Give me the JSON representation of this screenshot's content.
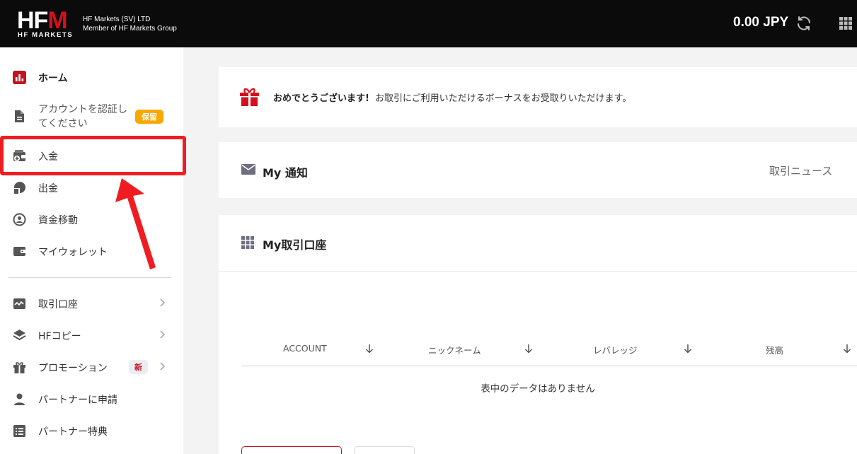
{
  "header": {
    "logo_text": "HFM",
    "logo_sub": "HF MARKETS",
    "company_line1": "HF Markets (SV) LTD",
    "company_line2": "Member of HF Markets Group",
    "balance": "0.00 JPY"
  },
  "sidebar": {
    "items": [
      {
        "label": "ホーム",
        "icon": "chart-icon"
      },
      {
        "label": "アカウントを認証してください",
        "icon": "document-icon",
        "badge": "保留"
      },
      {
        "label": "入金",
        "icon": "wallet-add-icon"
      },
      {
        "label": "出金",
        "icon": "withdraw-icon"
      },
      {
        "label": "資金移動",
        "icon": "transfer-icon"
      },
      {
        "label": "マイウォレット",
        "icon": "wallet-icon"
      },
      {
        "label": "取引口座",
        "icon": "trading-chart-icon"
      },
      {
        "label": "HFコピー",
        "icon": "layers-icon"
      },
      {
        "label": "プロモーション",
        "icon": "gift-icon",
        "badge": "新"
      },
      {
        "label": "パートナーに申請",
        "icon": "person-icon"
      },
      {
        "label": "パートナー特典",
        "icon": "list-icon"
      }
    ]
  },
  "bonus": {
    "strong": "おめでとうございます!",
    "text": "お取引にご利用いただけるボーナスをお受取りいただけます。"
  },
  "notice": {
    "title": "My 通知",
    "news_link": "取引ニュース"
  },
  "accounts": {
    "title": "My取引口座",
    "columns": [
      "ACCOUNT",
      "ニックネーム",
      "レバレッジ",
      "残高"
    ],
    "empty_message": "表中のデータはありません"
  },
  "colors": {
    "brand_red": "#d5101c",
    "highlight": "#ef1d22",
    "pending_badge": "#f8a800"
  }
}
